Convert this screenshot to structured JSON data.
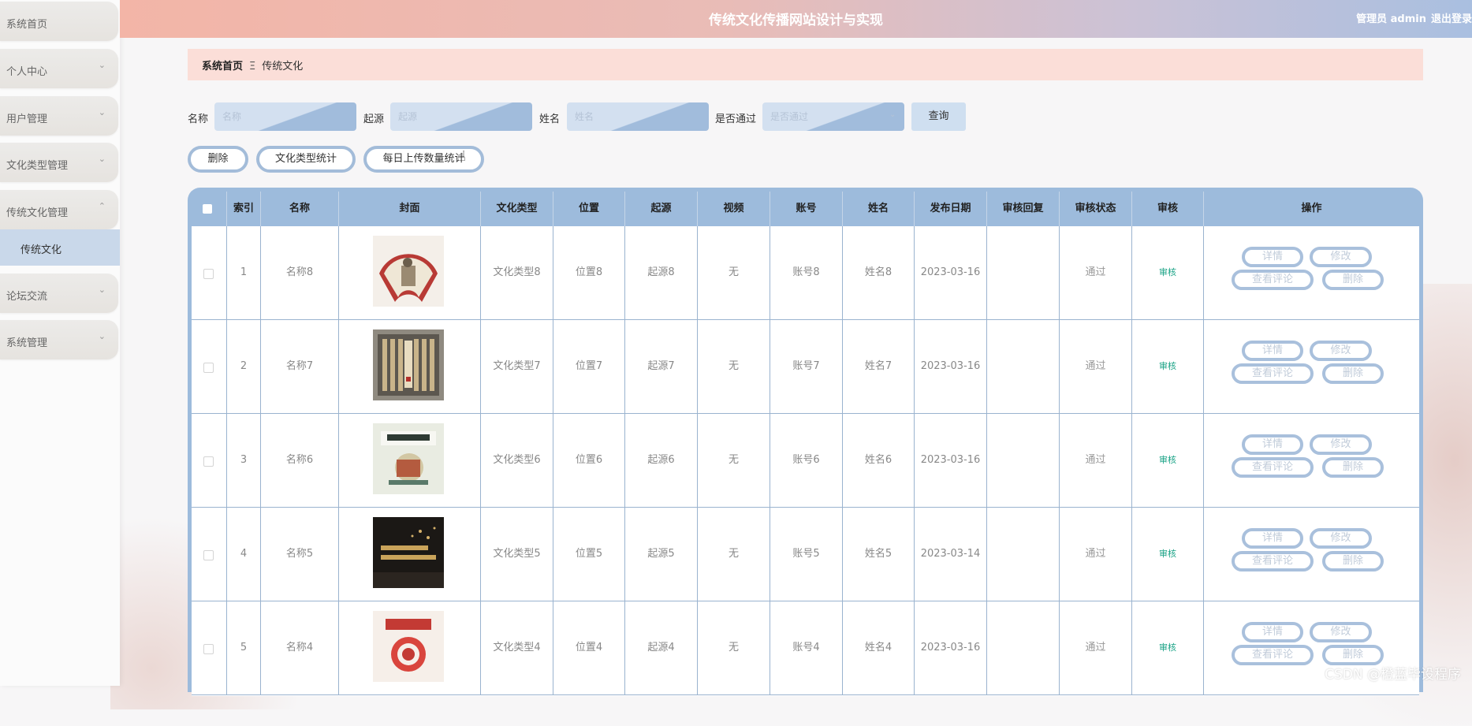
{
  "header": {
    "title": "传统文化传播网站设计与实现",
    "user": "管理员 admin",
    "logout": "退出登录"
  },
  "sidebar": {
    "items": [
      {
        "label": "系统首页",
        "expandable": false
      },
      {
        "label": "个人中心",
        "expandable": true
      },
      {
        "label": "用户管理",
        "expandable": true
      },
      {
        "label": "文化类型管理",
        "expandable": true
      },
      {
        "label": "传统文化管理",
        "expandable": true,
        "expanded": true
      },
      {
        "label": "论坛交流",
        "expandable": true
      },
      {
        "label": "系统管理",
        "expandable": true
      }
    ],
    "submenu": {
      "label": "传统文化"
    }
  },
  "breadcrumb": {
    "home": "系统首页",
    "separator": "Ξ",
    "current": "传统文化"
  },
  "search": {
    "name_label": "名称",
    "name_placeholder": "名称",
    "origin_label": "起源",
    "origin_placeholder": "起源",
    "person_label": "姓名",
    "person_placeholder": "姓名",
    "pass_label": "是否通过",
    "pass_placeholder": "是否通过",
    "query_button": "查询"
  },
  "actions": {
    "delete": "删除",
    "type_stats": "文化类型统计",
    "daily_upload_stats": "每日上传数量统计"
  },
  "table": {
    "columns": [
      "索引",
      "名称",
      "封面",
      "文化类型",
      "位置",
      "起源",
      "视频",
      "账号",
      "姓名",
      "发布日期",
      "审核回复",
      "审核状态",
      "审核",
      "操作"
    ],
    "rows": [
      {
        "index": "1",
        "name": "名称8",
        "type": "文化类型8",
        "location": "位置8",
        "origin": "起源8",
        "video": "无",
        "account": "账号8",
        "person": "姓名8",
        "date": "2023-03-16",
        "reply": "",
        "status": "通过",
        "audit": "审核",
        "cover": "fan-painting"
      },
      {
        "index": "2",
        "name": "名称7",
        "type": "文化类型7",
        "location": "位置7",
        "origin": "起源7",
        "video": "无",
        "account": "账号7",
        "person": "姓名7",
        "date": "2023-03-16",
        "reply": "",
        "status": "通过",
        "audit": "审核",
        "cover": "bamboo-scroll"
      },
      {
        "index": "3",
        "name": "名称6",
        "type": "文化类型6",
        "location": "位置6",
        "origin": "起源6",
        "video": "无",
        "account": "账号6",
        "person": "姓名6",
        "date": "2023-03-16",
        "reply": "",
        "status": "通过",
        "audit": "审核",
        "cover": "book-cover"
      },
      {
        "index": "4",
        "name": "名称5",
        "type": "文化类型5",
        "location": "位置5",
        "origin": "起源5",
        "video": "无",
        "account": "账号5",
        "person": "姓名5",
        "date": "2023-03-14",
        "reply": "",
        "status": "通过",
        "audit": "审核",
        "cover": "dark-poster"
      },
      {
        "index": "5",
        "name": "名称4",
        "type": "文化类型4",
        "location": "位置4",
        "origin": "起源4",
        "video": "无",
        "account": "账号4",
        "person": "姓名4",
        "date": "2023-03-16",
        "reply": "",
        "status": "通过",
        "audit": "审核",
        "cover": "red-poster"
      }
    ],
    "row_ops": {
      "detail": "详情",
      "edit": "修改",
      "comments": "查看评论",
      "delete": "删除"
    }
  },
  "watermark": "CSDN @橙蓝毕设程序",
  "colors": {
    "accent": "#9dbbdc",
    "header_start": "#f3b5a7",
    "header_end": "#a9bfe0",
    "breadcrumb_bg": "#fbded8",
    "audit_link": "#1aa386"
  }
}
